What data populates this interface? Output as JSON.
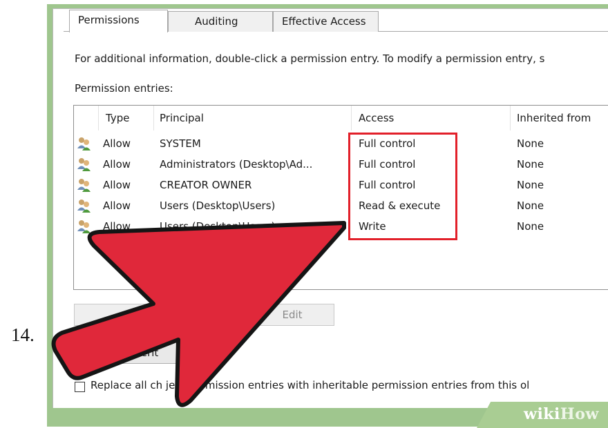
{
  "step_number": "14.",
  "tabs": [
    {
      "label": "Permissions",
      "active": true
    },
    {
      "label": "Auditing",
      "active": false
    },
    {
      "label": "Effective Access",
      "active": false
    }
  ],
  "info_text": "For additional information, double-click a permission entry. To modify a permission entry, s",
  "entries_label": "Permission entries:",
  "columns": [
    "Type",
    "Principal",
    "Access",
    "Inherited from"
  ],
  "rows": [
    {
      "type": "Allow",
      "principal": "SYSTEM",
      "access": "Full control",
      "inherited": "None"
    },
    {
      "type": "Allow",
      "principal": "Administrators (Desktop\\Ad...",
      "access": "Full control",
      "inherited": "None"
    },
    {
      "type": "Allow",
      "principal": "CREATOR OWNER",
      "access": "Full control",
      "inherited": "None"
    },
    {
      "type": "Allow",
      "principal": "Users (Desktop\\Users)",
      "access": "Read & execute",
      "inherited": "None"
    },
    {
      "type": "Allow",
      "principal": "Users (Desktop\\Users)",
      "access": "Write",
      "inherited": "None"
    }
  ],
  "buttons": {
    "edit": "Edit"
  },
  "inherit_button_visible": "ble inherit",
  "replace_checkbox_label": "Replace all ch      ject permission entries with inheritable permission entries from this ol",
  "watermark": {
    "part1": "wiki",
    "part2": "How"
  },
  "colors": {
    "arrow": "#e0283a",
    "highlight": "#e2202a",
    "frame": "#9fc68e"
  }
}
